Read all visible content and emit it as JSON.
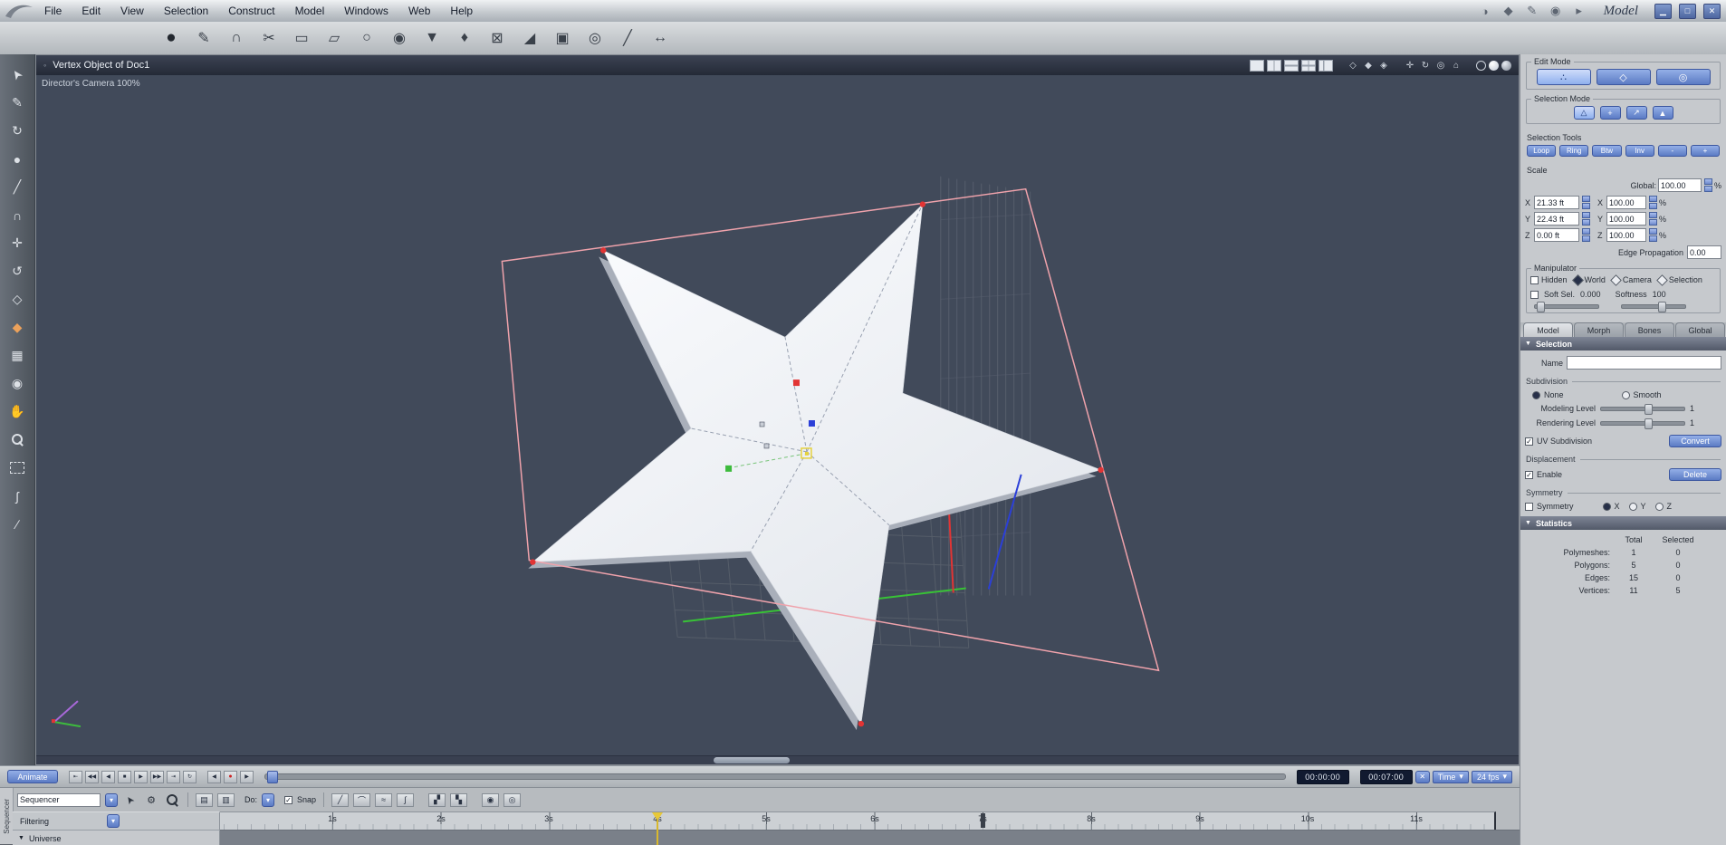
{
  "colors": {
    "accent_blue": "#5b7bc4",
    "panel_bg": "#c6c9cd",
    "viewport_bg": "#414a5a",
    "star_fill": "#f2f4f7",
    "selection_pink": "#efa2ab",
    "playhead_yellow": "#e7c839"
  },
  "menubar": {
    "menus": [
      "File",
      "Edit",
      "View",
      "Selection",
      "Construct",
      "Model",
      "Windows",
      "Web",
      "Help"
    ],
    "room_label": "Model"
  },
  "icons": {
    "rooms": [
      {
        "name": "assemble-room",
        "glyph": "◑"
      },
      {
        "name": "model-room",
        "glyph": "◆"
      },
      {
        "name": "texture-room",
        "glyph": "✎"
      },
      {
        "name": "render-room",
        "glyph": "◉"
      },
      {
        "name": "animate-room",
        "glyph": "▸"
      }
    ],
    "window": [
      {
        "name": "minimize",
        "glyph": "▁"
      },
      {
        "name": "restore",
        "glyph": "□"
      },
      {
        "name": "close",
        "glyph": "✕"
      }
    ],
    "toolbar": [
      {
        "name": "sphere-tool",
        "glyph": "●"
      },
      {
        "name": "draw-polygon-tool",
        "glyph": "✎"
      },
      {
        "name": "magnet-tool",
        "glyph": "∩"
      },
      {
        "name": "scissors-tool",
        "glyph": "✂"
      },
      {
        "name": "plane-tool",
        "glyph": "▭"
      },
      {
        "name": "skew-tool",
        "glyph": "▱"
      },
      {
        "name": "disc-tool",
        "glyph": "○"
      },
      {
        "name": "weld-tool",
        "glyph": "◉"
      },
      {
        "name": "cone-tool",
        "glyph": "▼"
      },
      {
        "name": "gem-tool",
        "glyph": "♦"
      },
      {
        "name": "delete-face-tool",
        "glyph": "⊠"
      },
      {
        "name": "ramp-tool",
        "glyph": "◢"
      },
      {
        "name": "fill-tool",
        "glyph": "▣"
      },
      {
        "name": "oval-tool",
        "glyph": "◎"
      },
      {
        "name": "line-tool",
        "glyph": "╱"
      },
      {
        "name": "sweep-tool",
        "glyph": "↔"
      }
    ],
    "left_tools": [
      {
        "name": "select-arrow",
        "glyph": "➤"
      },
      {
        "name": "pen",
        "glyph": "✎"
      },
      {
        "name": "rotate-view",
        "glyph": "↻"
      },
      {
        "name": "sphere-primitive",
        "glyph": "●"
      },
      {
        "name": "polyline",
        "glyph": "╱"
      },
      {
        "name": "magnet",
        "glyph": "∩"
      },
      {
        "name": "move-tool",
        "glyph": "✛"
      },
      {
        "name": "rotate-tool",
        "glyph": "↺"
      },
      {
        "name": "scale-tool",
        "glyph": "◇"
      },
      {
        "name": "soft-select",
        "glyph": "◆"
      },
      {
        "name": "paint-select",
        "glyph": "▦"
      },
      {
        "name": "camera",
        "glyph": "◉"
      },
      {
        "name": "pan-hand",
        "glyph": "✋"
      },
      {
        "name": "lasso",
        "glyph": "ʃ"
      },
      {
        "name": "knife",
        "glyph": "∕"
      }
    ],
    "vp_display": [
      {
        "name": "display-a",
        "glyph": "◇"
      },
      {
        "name": "display-b",
        "glyph": "◆"
      },
      {
        "name": "display-c",
        "glyph": "◈"
      }
    ],
    "vp_nav": [
      {
        "name": "pan-camera",
        "glyph": "✛"
      },
      {
        "name": "rotate-camera",
        "glyph": "↻"
      },
      {
        "name": "dolly-camera",
        "glyph": "◎"
      },
      {
        "name": "reset-camera",
        "glyph": "⌂"
      }
    ]
  },
  "viewport": {
    "title": "Vertex Object of Doc1",
    "marker": "◦",
    "camera_label": "Director's Camera 100%"
  },
  "right_panel": {
    "edit_mode": {
      "label": "Edit Mode",
      "buttons": [
        {
          "name": "vertex-mode",
          "glyph": "∴"
        },
        {
          "name": "edge-mode",
          "glyph": "◇"
        },
        {
          "name": "sphere-mode",
          "glyph": "◎"
        }
      ]
    },
    "selection_mode": {
      "label": "Selection Mode",
      "buttons": [
        {
          "name": "point-select",
          "glyph": "△"
        },
        {
          "name": "add-select",
          "glyph": "+"
        },
        {
          "name": "line-select",
          "glyph": "↗"
        },
        {
          "name": "poly-select",
          "glyph": "▲"
        }
      ]
    },
    "selection_tools": {
      "label": "Selection Tools",
      "buttons": [
        "Loop",
        "Ring",
        "Btw",
        "Inv",
        "-",
        "+"
      ]
    },
    "scale": {
      "label": "Scale",
      "global_label": "Global:",
      "global_value": "100.00",
      "percent_unit": "%",
      "rows": [
        {
          "axis": "X",
          "size": "21.33 ft",
          "pct": "100.00"
        },
        {
          "axis": "Y",
          "size": "22.43 ft",
          "pct": "100.00"
        },
        {
          "axis": "Z",
          "size": "0.00 ft",
          "pct": "100.00"
        }
      ],
      "edge_label": "Edge Propagation",
      "edge_value": "0.00"
    },
    "manipulator": {
      "label": "Manipulator",
      "hidden_label": "Hidden",
      "world_label": "World",
      "camera_label": "Camera",
      "selection_label": "Selection",
      "soft_label": "Soft Sel.",
      "soft_value": "0.000",
      "softness_label": "Softness",
      "softness_value": "100"
    },
    "tabs": [
      "Model",
      "Morph",
      "Bones",
      "Global"
    ],
    "selection_section": {
      "label": "Selection",
      "name_label": "Name",
      "name_value": ""
    },
    "subdivision": {
      "label": "Subdivision",
      "none_label": "None",
      "smooth_label": "Smooth",
      "modeling_label": "Modeling Level",
      "modeling_value": "1",
      "rendering_label": "Rendering Level",
      "rendering_value": "1",
      "uv_label": "UV Subdivision",
      "convert_label": "Convert"
    },
    "displacement": {
      "label": "Displacement",
      "enable_label": "Enable",
      "delete_label": "Delete"
    },
    "symmetry": {
      "label": "Symmetry",
      "checkbox_label": "Symmetry",
      "x": "X",
      "y": "Y",
      "z": "Z"
    },
    "statistics": {
      "label": "Statistics",
      "col_total": "Total",
      "col_selected": "Selected",
      "rows": [
        {
          "label": "Polymeshes:",
          "total": "1",
          "selected": "0"
        },
        {
          "label": "Polygons:",
          "total": "5",
          "selected": "0"
        },
        {
          "label": "Edges:",
          "total": "15",
          "selected": "0"
        },
        {
          "label": "Vertices:",
          "total": "11",
          "selected": "5"
        }
      ]
    }
  },
  "transport": {
    "animate_label": "Animate",
    "buttons": [
      {
        "name": "go-start",
        "glyph": "⇤"
      },
      {
        "name": "fast-reverse",
        "glyph": "◀◀"
      },
      {
        "name": "play-reverse",
        "glyph": "◀"
      },
      {
        "name": "stop",
        "glyph": "■"
      },
      {
        "name": "play",
        "glyph": "▶"
      },
      {
        "name": "fast-forward",
        "glyph": "▶▶"
      },
      {
        "name": "go-end",
        "glyph": "⇥"
      },
      {
        "name": "loop",
        "glyph": "↻"
      }
    ],
    "frame_buttons": [
      {
        "name": "prev-frame",
        "glyph": "◀"
      },
      {
        "name": "record",
        "glyph": "●"
      },
      {
        "name": "next-frame",
        "glyph": "▶"
      }
    ],
    "time_current": "00:00:00",
    "time_end": "00:07:00",
    "close_glyph": "✕",
    "time_mode_label": "Time",
    "fps_label": "24 fps",
    "dd_arrow": "▾"
  },
  "timeline": {
    "side_tab": "Sequencer",
    "selector_value": "Sequencer",
    "do_label": "Do:",
    "snap_label": "Snap",
    "filtering_label": "Filtering",
    "universe_label": "Universe",
    "universe_arrow": "▼",
    "ruler_labels": [
      "1s",
      "2s",
      "3s",
      "4s",
      "5s",
      "6s",
      "7s",
      "8s",
      "9s",
      "10s",
      "11s"
    ],
    "header_icons": [
      {
        "name": "pick-cursor",
        "glyph": "➤"
      },
      {
        "name": "gear",
        "glyph": "⚙"
      },
      {
        "name": "pane-horizontal",
        "glyph": "▤"
      },
      {
        "name": "pane-vertical",
        "glyph": "▥"
      },
      {
        "name": "linear-tweener",
        "glyph": "╱"
      },
      {
        "name": "bezier-tweener",
        "glyph": "⌒"
      },
      {
        "name": "oscillate-tweener",
        "glyph": "≈"
      },
      {
        "name": "formula-tweener",
        "glyph": "∫"
      },
      {
        "name": "keyframe-view",
        "glyph": "▞"
      },
      {
        "name": "curve-view",
        "glyph": "▚"
      },
      {
        "name": "camera-solid",
        "glyph": "◉"
      },
      {
        "name": "camera-outline",
        "glyph": "◎"
      }
    ]
  }
}
